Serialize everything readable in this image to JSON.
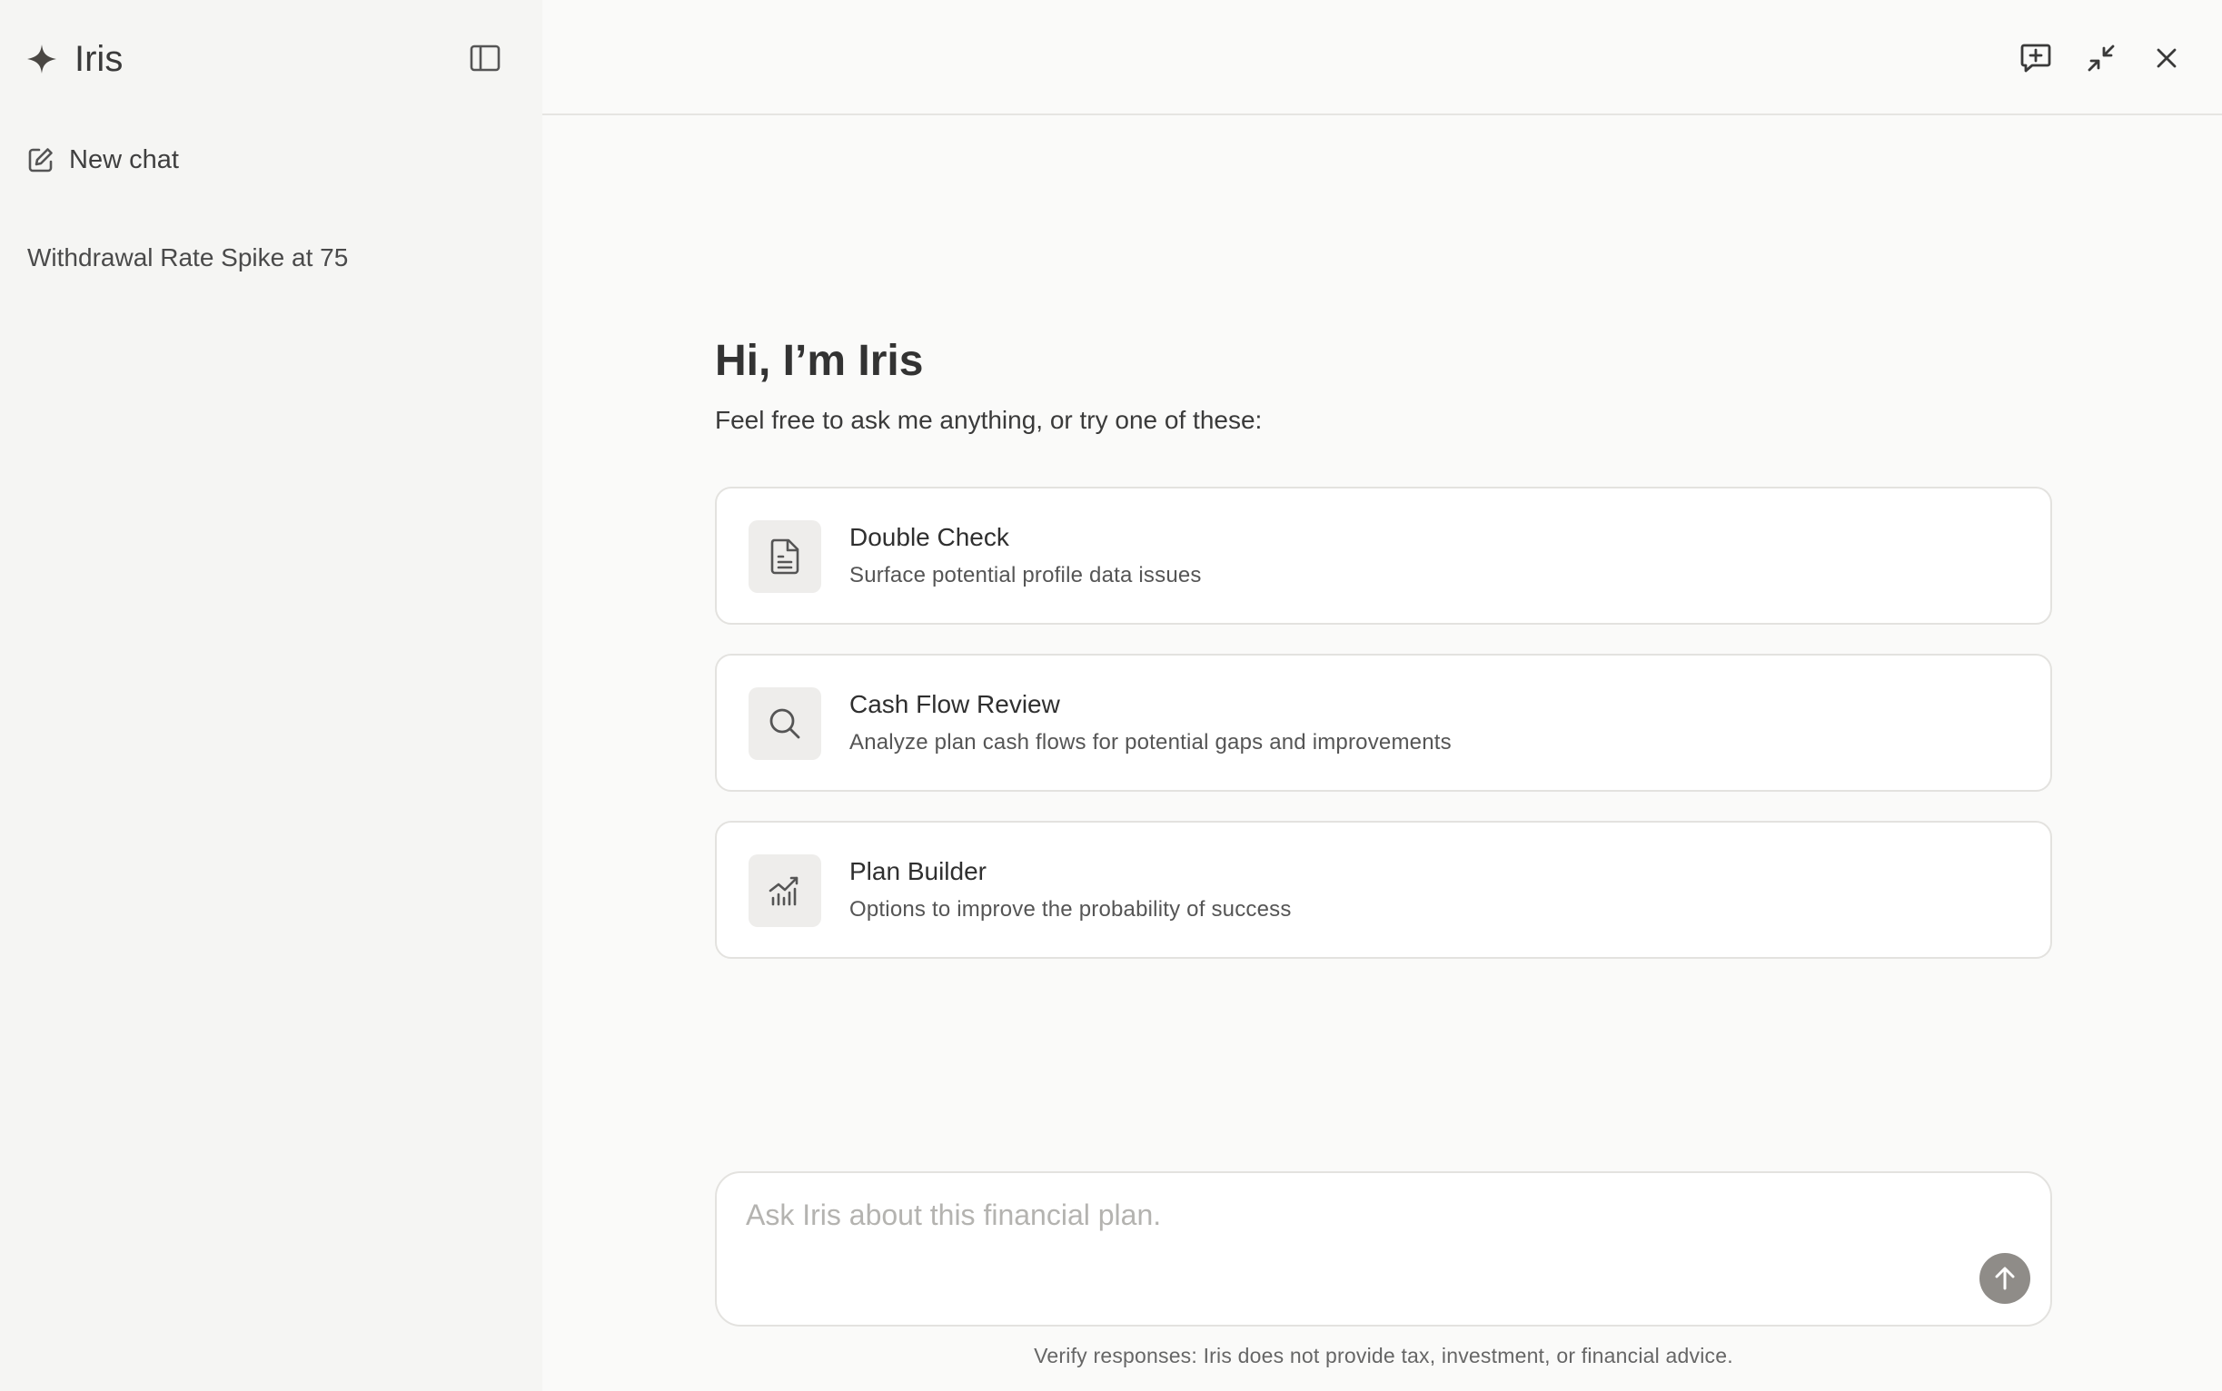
{
  "app": {
    "name": "Iris",
    "accent_color": "#4a4743",
    "send_button_color": "#8f8c88"
  },
  "sidebar": {
    "toggle_icon": "sidebar-panel-icon",
    "new_chat": {
      "label": "New chat",
      "icon": "edit-icon"
    },
    "history": [
      {
        "title": "Withdrawal Rate Spike at 75"
      }
    ]
  },
  "topbar": {
    "actions": [
      {
        "name": "new-chat-bubble-icon"
      },
      {
        "name": "minimize-icon"
      },
      {
        "name": "close-icon"
      }
    ]
  },
  "welcome": {
    "greeting": "Hi, I’m Iris",
    "subtitle": "Feel free to ask me anything, or try one of these:"
  },
  "suggestions": [
    {
      "title": "Double Check",
      "description": "Surface potential profile data issues",
      "icon": "document-icon"
    },
    {
      "title": "Cash Flow Review",
      "description": "Analyze plan cash flows for potential gaps and improvements",
      "icon": "search-icon"
    },
    {
      "title": "Plan Builder",
      "description": "Options to improve the probability of success",
      "icon": "chart-trend-icon"
    }
  ],
  "composer": {
    "placeholder": "Ask Iris about this financial plan.",
    "value": "",
    "send_icon": "arrow-up-icon"
  },
  "disclaimer": "Verify responses: Iris does not provide tax, investment, or financial advice."
}
